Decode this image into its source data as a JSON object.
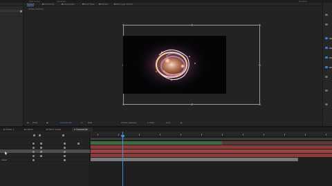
{
  "app": {
    "top_tabs": [
      {
        "label": "Edit Comp"
      },
      {
        "label": "Libraries"
      },
      {
        "label": "Window"
      }
    ]
  },
  "viewer": {
    "tabs": [
      {
        "label": "Output",
        "active": true
      },
      {
        "label": "Full Comp",
        "active": false
      },
      {
        "label": "Composite",
        "active": false
      },
      {
        "label": "Flow View",
        "active": false
      },
      {
        "label": "Tracker",
        "active": false
      },
      {
        "label": "Ref Layer Frame",
        "active": false
      }
    ],
    "subheader": "Active Camera",
    "toolbar": {
      "zoom": "(Full)",
      "resolution": "Half",
      "timecode": "0;00;02;28",
      "camera": "Active Camera",
      "views": "1 View",
      "exposure": "+0.0"
    }
  },
  "timeline": {
    "tabs": [
      {
        "label": "Comp 1",
        "active": false
      },
      {
        "label": "Lights",
        "active": false
      },
      {
        "label": "Dark Comp",
        "active": false
      },
      {
        "label": "Composite",
        "active": true
      }
    ],
    "layers": [
      {
        "name": "",
        "selected": false
      },
      {
        "name": "",
        "selected": false
      },
      {
        "name": "",
        "selected": true
      },
      {
        "name": "",
        "selected": false
      },
      {
        "name": "Layer",
        "selected": false
      }
    ],
    "playhead_fraction": 0.135
  },
  "colors": {
    "accent": "#3b7ddd",
    "bar_red": "#8a3c3c",
    "bar_green": "#3c6b3c",
    "bar_gray": "#7a7a7a"
  }
}
